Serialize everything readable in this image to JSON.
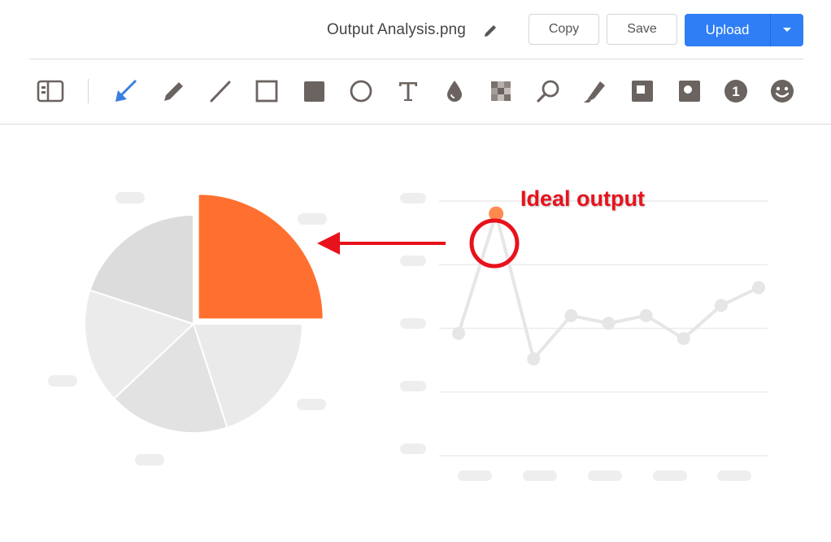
{
  "header": {
    "filename": "Output Analysis.png",
    "copy_label": "Copy",
    "save_label": "Save",
    "upload_label": "Upload"
  },
  "toolbar": {
    "tools": [
      "sidebar-toggle",
      "arrow",
      "pencil",
      "line",
      "rectangle",
      "filled-rectangle",
      "ellipse",
      "text",
      "blur-drop",
      "pixelate",
      "magnifier",
      "highlighter",
      "filled-square-outline",
      "filled-circle-outline",
      "step-number",
      "emoji"
    ],
    "active_tool": "arrow",
    "step_number_value": "1",
    "accent_color": "#3a7fe0"
  },
  "annotation": {
    "label": "Ideal output",
    "color": "#e8121c"
  },
  "chart_data": [
    {
      "type": "pie",
      "values": [
        25,
        20,
        18,
        17,
        20
      ],
      "colors": [
        "#ff7030",
        "#eaeaea",
        "#e2e2e2",
        "#ebebeb",
        "#dcdcdc"
      ],
      "highlighted_slice": 0
    },
    {
      "type": "line",
      "x": [
        1,
        2,
        3,
        4,
        5,
        6,
        7,
        8,
        9
      ],
      "values": [
        0.48,
        0.95,
        0.38,
        0.55,
        0.52,
        0.55,
        0.46,
        0.59,
        0.66
      ],
      "highlighted_point": 1,
      "highlight_color": "#ff8a50",
      "line_color": "#e6e6e6",
      "grid": true
    }
  ]
}
